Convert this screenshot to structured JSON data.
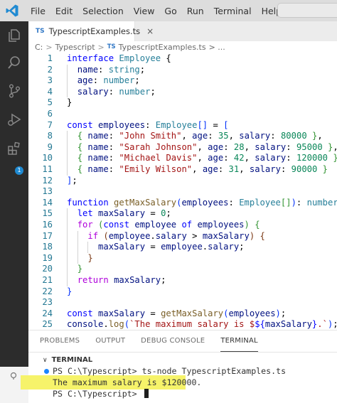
{
  "menu": {
    "logo_icon": "vscode-logo-icon",
    "items": [
      "File",
      "Edit",
      "Selection",
      "View",
      "Go",
      "Run",
      "Terminal",
      "Help"
    ],
    "back_icon": "arrow-left-icon",
    "forward_icon": "arrow-right-icon"
  },
  "activity_bar": {
    "icons": [
      "explorer-icon",
      "search-icon",
      "source-control-icon",
      "run-debug-icon",
      "extensions-icon"
    ],
    "extensions_badge": "1"
  },
  "tab": {
    "badge": "TS",
    "label": "TypescriptExamples.ts",
    "close": "×"
  },
  "breadcrumb": {
    "root": "C:",
    "sep": ">",
    "folder": "Typescript",
    "file_badge": "TS",
    "file": "TypescriptExamples.ts",
    "trail": "> ..."
  },
  "editor": {
    "lines": [
      {
        "n": "1",
        "tokens": [
          [
            "k",
            "interface "
          ],
          [
            "t",
            "Employee"
          ],
          [
            "p",
            " {"
          ]
        ]
      },
      {
        "n": "2",
        "tokens": [
          [
            "p",
            "  "
          ],
          [
            "v",
            "name"
          ],
          [
            "p",
            ": "
          ],
          [
            "t",
            "string"
          ],
          [
            "p",
            ";"
          ]
        ]
      },
      {
        "n": "3",
        "tokens": [
          [
            "p",
            "  "
          ],
          [
            "v",
            "age"
          ],
          [
            "p",
            ": "
          ],
          [
            "t",
            "number"
          ],
          [
            "p",
            ";"
          ]
        ]
      },
      {
        "n": "4",
        "tokens": [
          [
            "p",
            "  "
          ],
          [
            "v",
            "salary"
          ],
          [
            "p",
            ": "
          ],
          [
            "t",
            "number"
          ],
          [
            "p",
            ";"
          ]
        ]
      },
      {
        "n": "5",
        "tokens": [
          [
            "p",
            "}"
          ]
        ]
      },
      {
        "n": "6",
        "tokens": []
      },
      {
        "n": "7",
        "tokens": [
          [
            "k",
            "const "
          ],
          [
            "v",
            "employees"
          ],
          [
            "p",
            ": "
          ],
          [
            "t",
            "Employee"
          ],
          [
            "br1",
            "[]"
          ],
          [
            "p",
            " = "
          ],
          [
            "br1",
            "["
          ]
        ]
      },
      {
        "n": "8",
        "tokens": [
          [
            "p",
            "  "
          ],
          [
            "br2",
            "{"
          ],
          [
            "p",
            " "
          ],
          [
            "v",
            "name"
          ],
          [
            "p",
            ": "
          ],
          [
            "s",
            "\"John Smith\""
          ],
          [
            "p",
            ", "
          ],
          [
            "v",
            "age"
          ],
          [
            "p",
            ": "
          ],
          [
            "n",
            "35"
          ],
          [
            "p",
            ", "
          ],
          [
            "v",
            "salary"
          ],
          [
            "p",
            ": "
          ],
          [
            "n",
            "80000"
          ],
          [
            "p",
            " "
          ],
          [
            "br2",
            "}"
          ],
          [
            "p",
            ","
          ]
        ]
      },
      {
        "n": "9",
        "tokens": [
          [
            "p",
            "  "
          ],
          [
            "br2",
            "{"
          ],
          [
            "p",
            " "
          ],
          [
            "v",
            "name"
          ],
          [
            "p",
            ": "
          ],
          [
            "s",
            "\"Sarah Johnson\""
          ],
          [
            "p",
            ", "
          ],
          [
            "v",
            "age"
          ],
          [
            "p",
            ": "
          ],
          [
            "n",
            "28"
          ],
          [
            "p",
            ", "
          ],
          [
            "v",
            "salary"
          ],
          [
            "p",
            ": "
          ],
          [
            "n",
            "95000"
          ],
          [
            "p",
            " "
          ],
          [
            "br2",
            "}"
          ],
          [
            "p",
            ","
          ]
        ]
      },
      {
        "n": "10",
        "tokens": [
          [
            "p",
            "  "
          ],
          [
            "br2",
            "{"
          ],
          [
            "p",
            " "
          ],
          [
            "v",
            "name"
          ],
          [
            "p",
            ": "
          ],
          [
            "s",
            "\"Michael Davis\""
          ],
          [
            "p",
            ", "
          ],
          [
            "v",
            "age"
          ],
          [
            "p",
            ": "
          ],
          [
            "n",
            "42"
          ],
          [
            "p",
            ", "
          ],
          [
            "v",
            "salary"
          ],
          [
            "p",
            ": "
          ],
          [
            "n",
            "120000"
          ],
          [
            "p",
            " "
          ],
          [
            "br2",
            "}"
          ],
          [
            "p",
            ","
          ]
        ]
      },
      {
        "n": "11",
        "tokens": [
          [
            "p",
            "  "
          ],
          [
            "br2",
            "{"
          ],
          [
            "p",
            " "
          ],
          [
            "v",
            "name"
          ],
          [
            "p",
            ": "
          ],
          [
            "s",
            "\"Emily Wilson\""
          ],
          [
            "p",
            ", "
          ],
          [
            "v",
            "age"
          ],
          [
            "p",
            ": "
          ],
          [
            "n",
            "31"
          ],
          [
            "p",
            ", "
          ],
          [
            "v",
            "salary"
          ],
          [
            "p",
            ": "
          ],
          [
            "n",
            "90000"
          ],
          [
            "p",
            " "
          ],
          [
            "br2",
            "}"
          ]
        ]
      },
      {
        "n": "12",
        "tokens": [
          [
            "br1",
            "]"
          ],
          [
            "p",
            ";"
          ]
        ]
      },
      {
        "n": "13",
        "tokens": []
      },
      {
        "n": "14",
        "tokens": [
          [
            "k",
            "function "
          ],
          [
            "f",
            "getMaxSalary"
          ],
          [
            "br1",
            "("
          ],
          [
            "v",
            "employees"
          ],
          [
            "p",
            ": "
          ],
          [
            "t",
            "Employee"
          ],
          [
            "br2",
            "[]"
          ],
          [
            "br1",
            ")"
          ],
          [
            "p",
            ": "
          ],
          [
            "t",
            "number"
          ],
          [
            "p",
            " "
          ],
          [
            "br1",
            "{"
          ]
        ]
      },
      {
        "n": "15",
        "tokens": [
          [
            "p",
            "  "
          ],
          [
            "k",
            "let "
          ],
          [
            "v",
            "maxSalary"
          ],
          [
            "p",
            " = "
          ],
          [
            "n",
            "0"
          ],
          [
            "p",
            ";"
          ]
        ]
      },
      {
        "n": "16",
        "tokens": [
          [
            "p",
            "  "
          ],
          [
            "kc",
            "for "
          ],
          [
            "br2",
            "("
          ],
          [
            "k",
            "const "
          ],
          [
            "v",
            "employee "
          ],
          [
            "k",
            "of "
          ],
          [
            "v",
            "employees"
          ],
          [
            "br2",
            ")"
          ],
          [
            "p",
            " "
          ],
          [
            "br2",
            "{"
          ]
        ]
      },
      {
        "n": "17",
        "tokens": [
          [
            "p",
            "    "
          ],
          [
            "kc",
            "if "
          ],
          [
            "br3",
            "("
          ],
          [
            "v",
            "employee"
          ],
          [
            "p",
            "."
          ],
          [
            "v",
            "salary"
          ],
          [
            "p",
            " > "
          ],
          [
            "v",
            "maxSalary"
          ],
          [
            "br3",
            ")"
          ],
          [
            "p",
            " "
          ],
          [
            "br3",
            "{"
          ]
        ]
      },
      {
        "n": "18",
        "tokens": [
          [
            "p",
            "      "
          ],
          [
            "v",
            "maxSalary"
          ],
          [
            "p",
            " = "
          ],
          [
            "v",
            "employee"
          ],
          [
            "p",
            "."
          ],
          [
            "v",
            "salary"
          ],
          [
            "p",
            ";"
          ]
        ]
      },
      {
        "n": "19",
        "tokens": [
          [
            "p",
            "    "
          ],
          [
            "br3",
            "}"
          ]
        ]
      },
      {
        "n": "20",
        "tokens": [
          [
            "p",
            "  "
          ],
          [
            "br2",
            "}"
          ]
        ]
      },
      {
        "n": "21",
        "tokens": [
          [
            "p",
            "  "
          ],
          [
            "kc",
            "return "
          ],
          [
            "v",
            "maxSalary"
          ],
          [
            "p",
            ";"
          ]
        ]
      },
      {
        "n": "22",
        "tokens": [
          [
            "br1",
            "}"
          ]
        ]
      },
      {
        "n": "23",
        "tokens": []
      },
      {
        "n": "24",
        "tokens": [
          [
            "k",
            "const "
          ],
          [
            "v",
            "maxSalary"
          ],
          [
            "p",
            " = "
          ],
          [
            "f",
            "getMaxSalary"
          ],
          [
            "br1",
            "("
          ],
          [
            "v",
            "employees"
          ],
          [
            "br1",
            ")"
          ],
          [
            "p",
            ";"
          ]
        ]
      },
      {
        "n": "25",
        "tokens": [
          [
            "v",
            "console"
          ],
          [
            "p",
            "."
          ],
          [
            "f",
            "log"
          ],
          [
            "br1",
            "("
          ],
          [
            "s",
            "`The maximum salary is $"
          ],
          [
            "k",
            "${"
          ],
          [
            "v",
            "maxSalary"
          ],
          [
            "k",
            "}"
          ],
          [
            "s",
            ".`"
          ],
          [
            "br1",
            ")"
          ],
          [
            "p",
            ";"
          ]
        ]
      }
    ]
  },
  "panel": {
    "tabs": [
      "PROBLEMS",
      "OUTPUT",
      "DEBUG CONSOLE",
      "TERMINAL"
    ],
    "active_tab": "TERMINAL",
    "section_chevron": "∨",
    "section_title": "TERMINAL",
    "terminal_lines": [
      "PS C:\\Typescript> ts-node TypescriptExamples.ts",
      "The maximum salary is $120000.",
      "PS C:\\Typescript> "
    ],
    "colors": {
      "highlight": "#f6f36a",
      "prompt_dot": "#1a85ff"
    }
  }
}
